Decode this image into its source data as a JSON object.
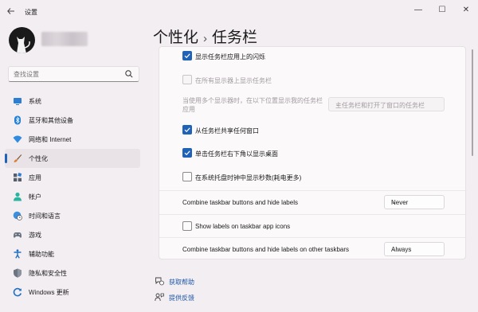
{
  "window": {
    "title": "设置",
    "controls": {
      "minimize": "—",
      "maximize": "☐",
      "close": "✕"
    }
  },
  "search": {
    "placeholder": "查找设置"
  },
  "nav": [
    {
      "label": "系统",
      "icon": "monitor-icon"
    },
    {
      "label": "蓝牙和其他设备",
      "icon": "bluetooth-icon"
    },
    {
      "label": "网络和 Internet",
      "icon": "wifi-icon"
    },
    {
      "label": "个性化",
      "icon": "brush-icon",
      "active": true
    },
    {
      "label": "应用",
      "icon": "apps-icon"
    },
    {
      "label": "帐户",
      "icon": "person-icon"
    },
    {
      "label": "时间和语言",
      "icon": "globe-clock-icon"
    },
    {
      "label": "游戏",
      "icon": "gamepad-icon"
    },
    {
      "label": "辅助功能",
      "icon": "accessibility-icon"
    },
    {
      "label": "隐私和安全性",
      "icon": "shield-icon"
    },
    {
      "label": "Windows 更新",
      "icon": "update-icon"
    }
  ],
  "breadcrumb": {
    "parent": "个性化",
    "separator": "›",
    "current": "任务栏"
  },
  "settings": {
    "flash": {
      "label": "显示任务栏应用上的闪烁",
      "checked": true
    },
    "all_displays": {
      "label": "在所有显示器上显示任务栏",
      "checked": false,
      "disabled": true
    },
    "multi_display": {
      "label": "当使用多个显示器时，在以下位置显示我的任务栏应用",
      "value": "主任务栏和打开了窗口的任务栏",
      "disabled": true
    },
    "share_window": {
      "label": "从任务栏共享任何窗口",
      "checked": true
    },
    "far_corner": {
      "label": "单击任务栏右下角以显示桌面",
      "checked": true
    },
    "seconds": {
      "label": "在系统托盘时钟中显示秒数(耗电更多)",
      "checked": false
    },
    "combine": {
      "label": "Combine taskbar buttons and hide labels",
      "value": "Never"
    },
    "show_labels": {
      "label": "Show labels on taskbar app icons",
      "checked": false
    },
    "combine_other": {
      "label": "Combine taskbar buttons and hide labels on other taskbars",
      "value": "Always"
    }
  },
  "links": {
    "help": "获取帮助",
    "feedback": "提供反馈"
  },
  "colors": {
    "accent": "#1f62b8"
  }
}
